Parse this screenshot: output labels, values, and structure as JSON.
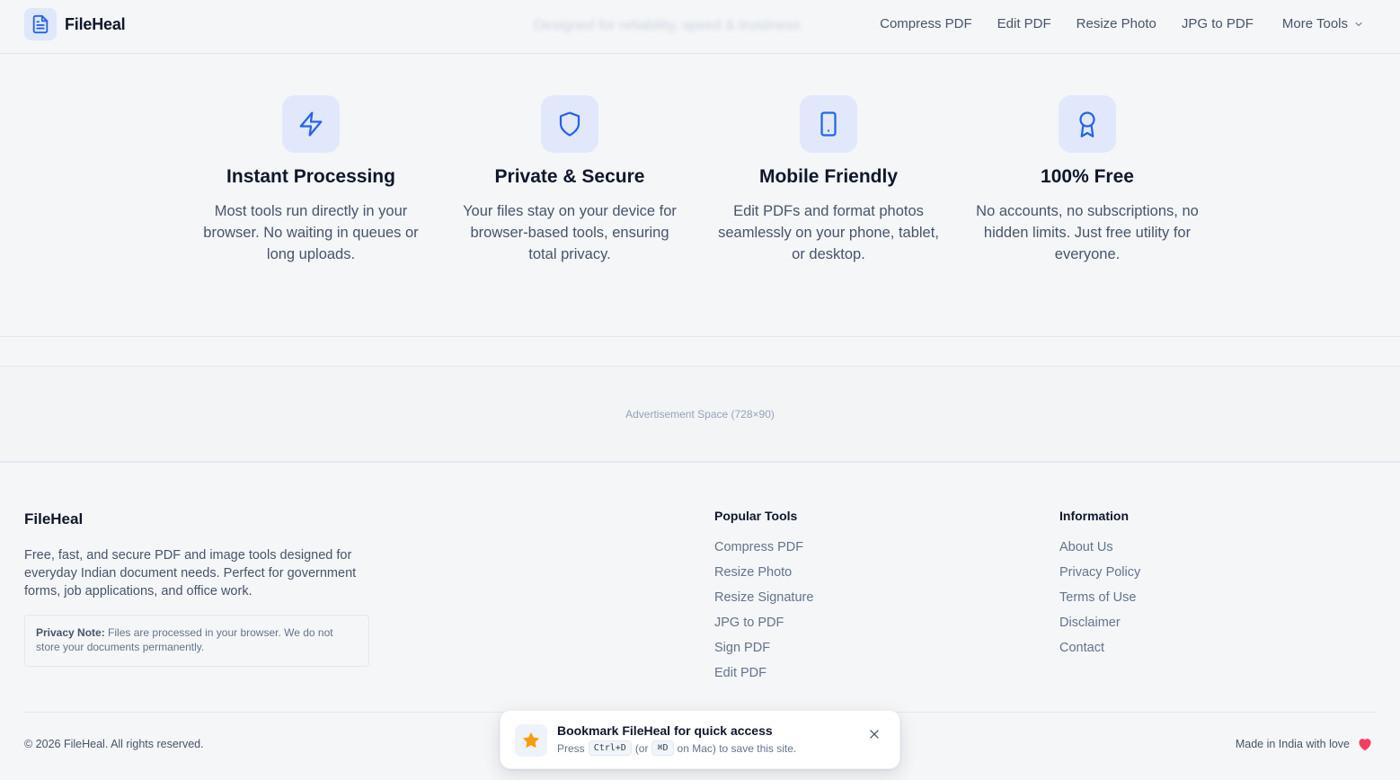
{
  "header": {
    "logo_text": "FileHeal",
    "background_text": "Designed for reliability, speed & trustiness",
    "nav": [
      "Compress PDF",
      "Edit PDF",
      "Resize Photo",
      "JPG to PDF"
    ],
    "more_tools": "More Tools"
  },
  "features": [
    {
      "title": "Instant Processing",
      "desc": "Most tools run directly in your browser. No waiting in queues or long uploads.",
      "icon": "lightning-icon"
    },
    {
      "title": "Private & Secure",
      "desc": "Your files stay on your device for browser-based tools, ensuring total privacy.",
      "icon": "shield-icon"
    },
    {
      "title": "Mobile Friendly",
      "desc": "Edit PDFs and format photos seamlessly on your phone, tablet, or desktop.",
      "icon": "phone-icon"
    },
    {
      "title": "100% Free",
      "desc": "No accounts, no subscriptions, no hidden limits. Just free utility for everyone.",
      "icon": "award-icon"
    }
  ],
  "ad": {
    "label": "Advertisement Space (728×90)"
  },
  "footer": {
    "brand": "FileHeal",
    "description": "Free, fast, and secure PDF and image tools designed for everyday Indian document needs. Perfect for government forms, job applications, and office work.",
    "privacy_label": "Privacy Note:",
    "privacy_text": "Files are processed in your browser. We do not store your documents permanently.",
    "popular_title": "Popular Tools",
    "popular_links": [
      "Compress PDF",
      "Resize Photo",
      "Resize Signature",
      "JPG to PDF",
      "Sign PDF",
      "Edit PDF"
    ],
    "info_title": "Information",
    "info_links": [
      "About Us",
      "Privacy Policy",
      "Terms of Use",
      "Disclaimer",
      "Contact"
    ],
    "copyright": "© 2026 FileHeal. All rights reserved.",
    "made_in": "Made in India with love"
  },
  "toast": {
    "title": "Bookmark FileHeal for quick access",
    "press": "Press",
    "key1": "Ctrl+D",
    "or": "(or",
    "key2": "⌘D",
    "suffix": "on Mac) to save this site."
  },
  "colors": {
    "accent": "#2563eb",
    "icon_bg": "#e1e8fb",
    "heart": "#f43f5e",
    "star": "#f59e0b"
  }
}
